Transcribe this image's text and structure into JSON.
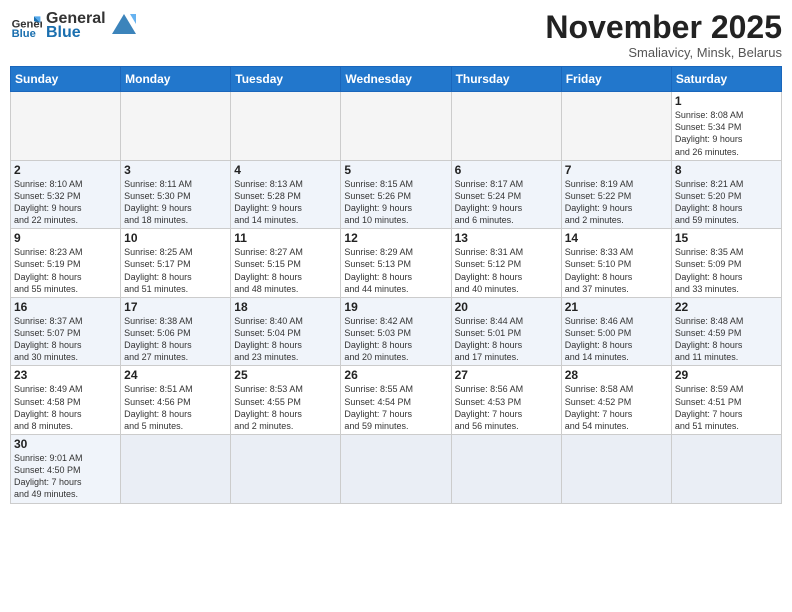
{
  "logo": {
    "general": "General",
    "blue": "Blue"
  },
  "title": "November 2025",
  "subtitle": "Smaliavicy, Minsk, Belarus",
  "days_of_week": [
    "Sunday",
    "Monday",
    "Tuesday",
    "Wednesday",
    "Thursday",
    "Friday",
    "Saturday"
  ],
  "weeks": [
    [
      {
        "day": "",
        "info": ""
      },
      {
        "day": "",
        "info": ""
      },
      {
        "day": "",
        "info": ""
      },
      {
        "day": "",
        "info": ""
      },
      {
        "day": "",
        "info": ""
      },
      {
        "day": "",
        "info": ""
      },
      {
        "day": "1",
        "info": "Sunrise: 8:08 AM\nSunset: 5:34 PM\nDaylight: 9 hours\nand 26 minutes."
      }
    ],
    [
      {
        "day": "2",
        "info": "Sunrise: 8:10 AM\nSunset: 5:32 PM\nDaylight: 9 hours\nand 22 minutes."
      },
      {
        "day": "3",
        "info": "Sunrise: 8:11 AM\nSunset: 5:30 PM\nDaylight: 9 hours\nand 18 minutes."
      },
      {
        "day": "4",
        "info": "Sunrise: 8:13 AM\nSunset: 5:28 PM\nDaylight: 9 hours\nand 14 minutes."
      },
      {
        "day": "5",
        "info": "Sunrise: 8:15 AM\nSunset: 5:26 PM\nDaylight: 9 hours\nand 10 minutes."
      },
      {
        "day": "6",
        "info": "Sunrise: 8:17 AM\nSunset: 5:24 PM\nDaylight: 9 hours\nand 6 minutes."
      },
      {
        "day": "7",
        "info": "Sunrise: 8:19 AM\nSunset: 5:22 PM\nDaylight: 9 hours\nand 2 minutes."
      },
      {
        "day": "8",
        "info": "Sunrise: 8:21 AM\nSunset: 5:20 PM\nDaylight: 8 hours\nand 59 minutes."
      }
    ],
    [
      {
        "day": "9",
        "info": "Sunrise: 8:23 AM\nSunset: 5:19 PM\nDaylight: 8 hours\nand 55 minutes."
      },
      {
        "day": "10",
        "info": "Sunrise: 8:25 AM\nSunset: 5:17 PM\nDaylight: 8 hours\nand 51 minutes."
      },
      {
        "day": "11",
        "info": "Sunrise: 8:27 AM\nSunset: 5:15 PM\nDaylight: 8 hours\nand 48 minutes."
      },
      {
        "day": "12",
        "info": "Sunrise: 8:29 AM\nSunset: 5:13 PM\nDaylight: 8 hours\nand 44 minutes."
      },
      {
        "day": "13",
        "info": "Sunrise: 8:31 AM\nSunset: 5:12 PM\nDaylight: 8 hours\nand 40 minutes."
      },
      {
        "day": "14",
        "info": "Sunrise: 8:33 AM\nSunset: 5:10 PM\nDaylight: 8 hours\nand 37 minutes."
      },
      {
        "day": "15",
        "info": "Sunrise: 8:35 AM\nSunset: 5:09 PM\nDaylight: 8 hours\nand 33 minutes."
      }
    ],
    [
      {
        "day": "16",
        "info": "Sunrise: 8:37 AM\nSunset: 5:07 PM\nDaylight: 8 hours\nand 30 minutes."
      },
      {
        "day": "17",
        "info": "Sunrise: 8:38 AM\nSunset: 5:06 PM\nDaylight: 8 hours\nand 27 minutes."
      },
      {
        "day": "18",
        "info": "Sunrise: 8:40 AM\nSunset: 5:04 PM\nDaylight: 8 hours\nand 23 minutes."
      },
      {
        "day": "19",
        "info": "Sunrise: 8:42 AM\nSunset: 5:03 PM\nDaylight: 8 hours\nand 20 minutes."
      },
      {
        "day": "20",
        "info": "Sunrise: 8:44 AM\nSunset: 5:01 PM\nDaylight: 8 hours\nand 17 minutes."
      },
      {
        "day": "21",
        "info": "Sunrise: 8:46 AM\nSunset: 5:00 PM\nDaylight: 8 hours\nand 14 minutes."
      },
      {
        "day": "22",
        "info": "Sunrise: 8:48 AM\nSunset: 4:59 PM\nDaylight: 8 hours\nand 11 minutes."
      }
    ],
    [
      {
        "day": "23",
        "info": "Sunrise: 8:49 AM\nSunset: 4:58 PM\nDaylight: 8 hours\nand 8 minutes."
      },
      {
        "day": "24",
        "info": "Sunrise: 8:51 AM\nSunset: 4:56 PM\nDaylight: 8 hours\nand 5 minutes."
      },
      {
        "day": "25",
        "info": "Sunrise: 8:53 AM\nSunset: 4:55 PM\nDaylight: 8 hours\nand 2 minutes."
      },
      {
        "day": "26",
        "info": "Sunrise: 8:55 AM\nSunset: 4:54 PM\nDaylight: 7 hours\nand 59 minutes."
      },
      {
        "day": "27",
        "info": "Sunrise: 8:56 AM\nSunset: 4:53 PM\nDaylight: 7 hours\nand 56 minutes."
      },
      {
        "day": "28",
        "info": "Sunrise: 8:58 AM\nSunset: 4:52 PM\nDaylight: 7 hours\nand 54 minutes."
      },
      {
        "day": "29",
        "info": "Sunrise: 8:59 AM\nSunset: 4:51 PM\nDaylight: 7 hours\nand 51 minutes."
      }
    ],
    [
      {
        "day": "30",
        "info": "Sunrise: 9:01 AM\nSunset: 4:50 PM\nDaylight: 7 hours\nand 49 minutes."
      },
      {
        "day": "",
        "info": ""
      },
      {
        "day": "",
        "info": ""
      },
      {
        "day": "",
        "info": ""
      },
      {
        "day": "",
        "info": ""
      },
      {
        "day": "",
        "info": ""
      },
      {
        "day": "",
        "info": ""
      }
    ]
  ]
}
